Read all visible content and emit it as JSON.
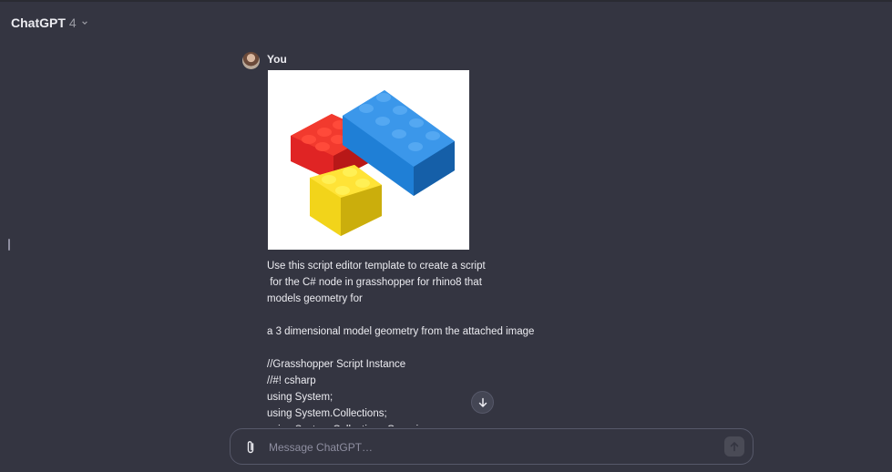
{
  "header": {
    "model_name": "ChatGPT",
    "model_version": "4"
  },
  "message": {
    "author": "You",
    "image_alt": "Red, blue and yellow toy building bricks",
    "lines": [
      "Use this script editor template to create a script",
      " for the C# node in grasshopper for rhino8 that",
      "models geometry for",
      "",
      "a 3 dimensional model geometry from the attached image",
      "",
      "//Grasshopper Script Instance",
      "//#! csharp",
      "using System;",
      "using System.Collections;",
      "using System.Collections.Generic;"
    ]
  },
  "composer": {
    "placeholder": "Message ChatGPT…",
    "value": ""
  },
  "icons": {
    "model_menu": "chevron-down-icon",
    "scroll": "arrow-down-icon",
    "attach": "paperclip-icon",
    "send": "arrow-up-icon"
  },
  "colors": {
    "background": "#343541",
    "text": "#ececf1",
    "muted": "#8e8ea0",
    "border": "#565869"
  }
}
